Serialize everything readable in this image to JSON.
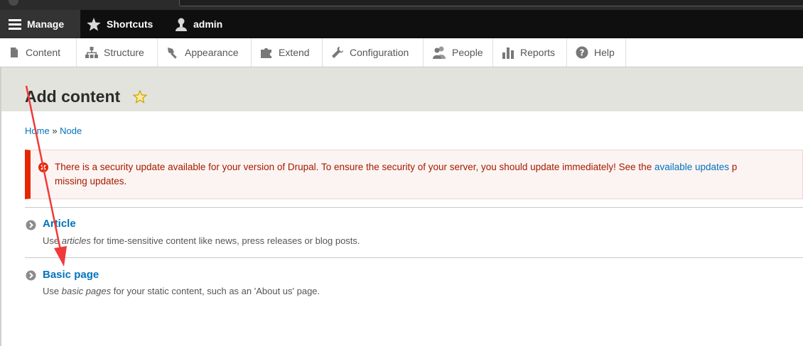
{
  "toolbar": {
    "manage_label": "Manage",
    "shortcuts_label": "Shortcuts",
    "admin_label": "admin"
  },
  "tray": {
    "items": [
      {
        "label": "Content",
        "icon": "content-icon"
      },
      {
        "label": "Structure",
        "icon": "structure-icon"
      },
      {
        "label": "Appearance",
        "icon": "appearance-icon"
      },
      {
        "label": "Extend",
        "icon": "extend-icon"
      },
      {
        "label": "Configuration",
        "icon": "configuration-icon"
      },
      {
        "label": "People",
        "icon": "people-icon"
      },
      {
        "label": "Reports",
        "icon": "reports-icon"
      },
      {
        "label": "Help",
        "icon": "help-icon"
      }
    ]
  },
  "page": {
    "title": "Add content"
  },
  "breadcrumb": {
    "home": "Home",
    "separator": "»",
    "current": "Node"
  },
  "message": {
    "line1_text": "There is a security update available for your version of Drupal. To ensure the security of your server, you should update immediately! See the ",
    "link_text": "available updates",
    "line1_tail": " p",
    "line2_text": "missing updates."
  },
  "content_types": [
    {
      "title": "Article",
      "desc_prefix": "Use ",
      "desc_em": "articles",
      "desc_suffix": " for time-sensitive content like news, press releases or blog posts."
    },
    {
      "title": "Basic page",
      "desc_prefix": "Use ",
      "desc_em": "basic pages",
      "desc_suffix": " for your static content, such as an 'About us' page."
    }
  ],
  "colors": {
    "link": "#0074bd",
    "error_red": "#e62600",
    "toolbar_black": "#0f0f0f",
    "header_bg": "#e3e3dd",
    "annotation_arrow": "#f03a3a"
  }
}
